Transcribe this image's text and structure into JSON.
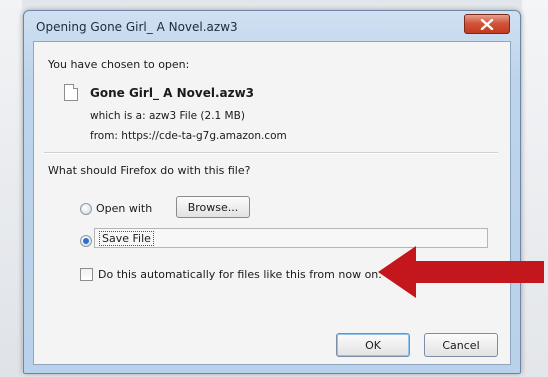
{
  "dialog": {
    "title": "Opening Gone Girl_ A Novel.azw3",
    "intro": "You have chosen to open:",
    "file_name": "Gone Girl_ A Novel.azw3",
    "which_is": "which is a:  azw3 File (2.1 MB)",
    "from": "from:  https://cde-ta-g7g.amazon.com",
    "question": "What should Firefox do with this file?",
    "open_with_label": "Open with",
    "browse_label": "Browse...",
    "save_file_label": "Save File",
    "auto_label": "Do this automatically for files like this from now on.",
    "ok_label": "OK",
    "cancel_label": "Cancel"
  },
  "state": {
    "selected_action": "Save File",
    "auto_checked": false
  },
  "colors": {
    "close_button": "#c8452a",
    "annotation_arrow": "#c4171d"
  },
  "icons": {
    "close": "close-icon",
    "file": "file-icon",
    "annotation": "arrow-icon"
  }
}
